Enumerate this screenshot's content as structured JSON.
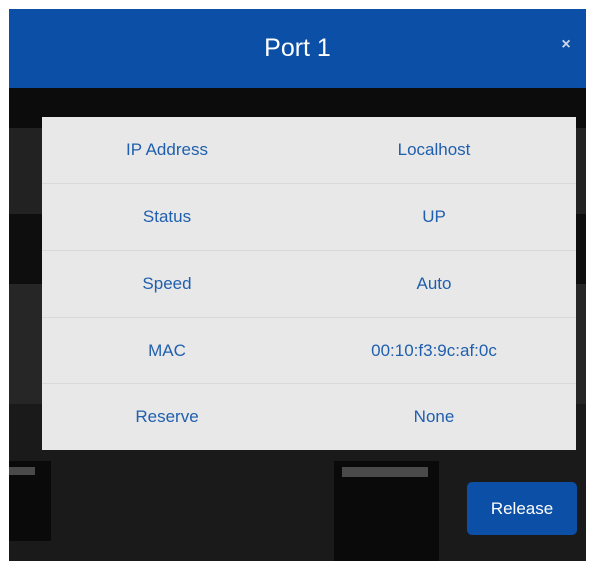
{
  "dialog": {
    "title": "Port 1",
    "close_icon": "close-icon",
    "close_glyph": "×"
  },
  "details": {
    "rows": [
      {
        "label": "IP Address",
        "value": "Localhost"
      },
      {
        "label": "Status",
        "value": "UP"
      },
      {
        "label": "Speed",
        "value": "Auto"
      },
      {
        "label": "MAC",
        "value": "00:10:f3:9c:af:0c"
      },
      {
        "label": "Reserve",
        "value": "None"
      }
    ]
  },
  "actions": {
    "release_label": "Release"
  },
  "colors": {
    "header_bg": "#0b4fa6",
    "button_bg": "#0b4fa6",
    "table_bg": "#e8e8e8",
    "text_accent": "#1f5fae",
    "backdrop": "#141414"
  }
}
